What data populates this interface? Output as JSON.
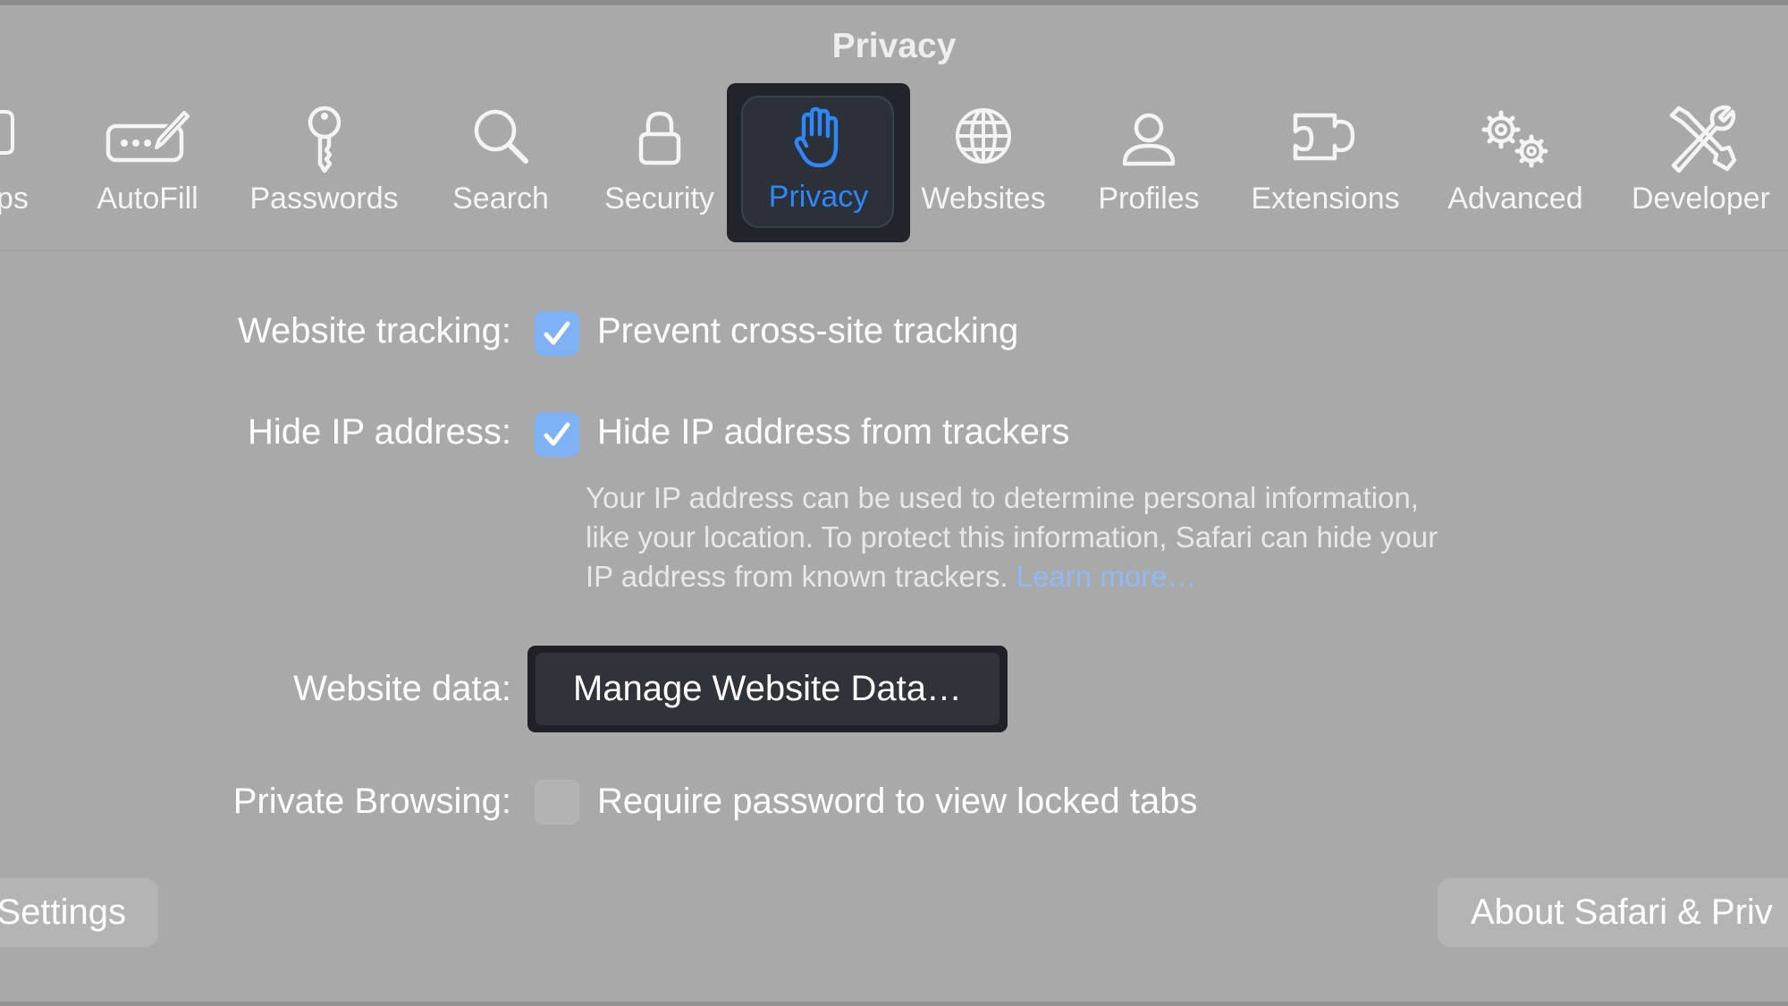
{
  "window": {
    "title": "Privacy"
  },
  "toolbar": {
    "tabs": [
      {
        "label": "ps",
        "icon": "tabs-icon"
      },
      {
        "label": "AutoFill",
        "icon": "autofill-icon"
      },
      {
        "label": "Passwords",
        "icon": "key-icon"
      },
      {
        "label": "Search",
        "icon": "magnifier-icon"
      },
      {
        "label": "Security",
        "icon": "lock-icon"
      },
      {
        "label": "Privacy",
        "icon": "hand-icon",
        "selected": true
      },
      {
        "label": "Websites",
        "icon": "globe-icon"
      },
      {
        "label": "Profiles",
        "icon": "person-icon"
      },
      {
        "label": "Extensions",
        "icon": "puzzle-icon"
      },
      {
        "label": "Advanced",
        "icon": "gears-icon"
      },
      {
        "label": "Developer",
        "icon": "tools-icon"
      }
    ]
  },
  "settings": {
    "website_tracking": {
      "label": "Website tracking:",
      "option": "Prevent cross-site tracking",
      "checked": true
    },
    "hide_ip": {
      "label": "Hide IP address:",
      "option": "Hide IP address from trackers",
      "checked": true,
      "description_line1": "Your IP address can be used to determine personal information,",
      "description_line2": "like your location. To protect this information, Safari can hide your",
      "description_line3": "IP address from known trackers.",
      "learn_more": "Learn more…"
    },
    "website_data": {
      "label": "Website data:",
      "button": "Manage Website Data…"
    },
    "private_browsing": {
      "label": "Private Browsing:",
      "option": "Require password to view locked tabs",
      "checked": false
    }
  },
  "footer": {
    "left_button": "Settings",
    "right_button": "About Safari & Priv"
  },
  "colors": {
    "window_bg": "#a9a9aa",
    "accent": "#2f86f6",
    "checkbox_checked": "#7fb1f5",
    "link": "#8fbaf5",
    "button_dark": "#2f333a"
  }
}
